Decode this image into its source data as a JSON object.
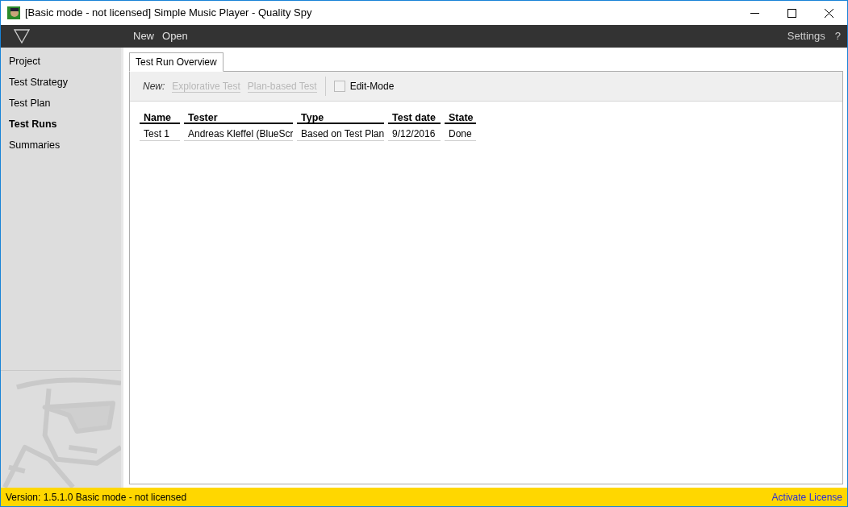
{
  "window": {
    "title": "[Basic mode - not licensed] Simple Music Player - Quality Spy"
  },
  "menu": {
    "items": [
      "New",
      "Open"
    ],
    "right_items": [
      "Settings",
      "?"
    ]
  },
  "sidebar": {
    "items": [
      {
        "label": "Project",
        "selected": false
      },
      {
        "label": "Test Strategy",
        "selected": false
      },
      {
        "label": "Test Plan",
        "selected": false
      },
      {
        "label": "Test Runs",
        "selected": true
      },
      {
        "label": "Summaries",
        "selected": false
      }
    ]
  },
  "tabs": [
    {
      "label": "Test Run Overview",
      "selected": true
    }
  ],
  "toolbar": {
    "new_label": "New:",
    "buttons": [
      {
        "label": "Explorative Test",
        "disabled": true
      },
      {
        "label": "Plan-based Test",
        "disabled": true
      }
    ],
    "edit_mode": {
      "label": "Edit-Mode",
      "checked": false
    }
  },
  "table": {
    "columns": [
      "Name",
      "Tester",
      "Type",
      "Test date",
      "State"
    ],
    "rows": [
      [
        "Test 1",
        "Andreas Kleffel (BlueScr",
        "Based on Test Plan",
        "9/12/2016",
        "Done"
      ]
    ]
  },
  "status_bar": {
    "text": "Version: 1.5.1.0  Basic mode - not licensed",
    "link": "Activate License"
  }
}
